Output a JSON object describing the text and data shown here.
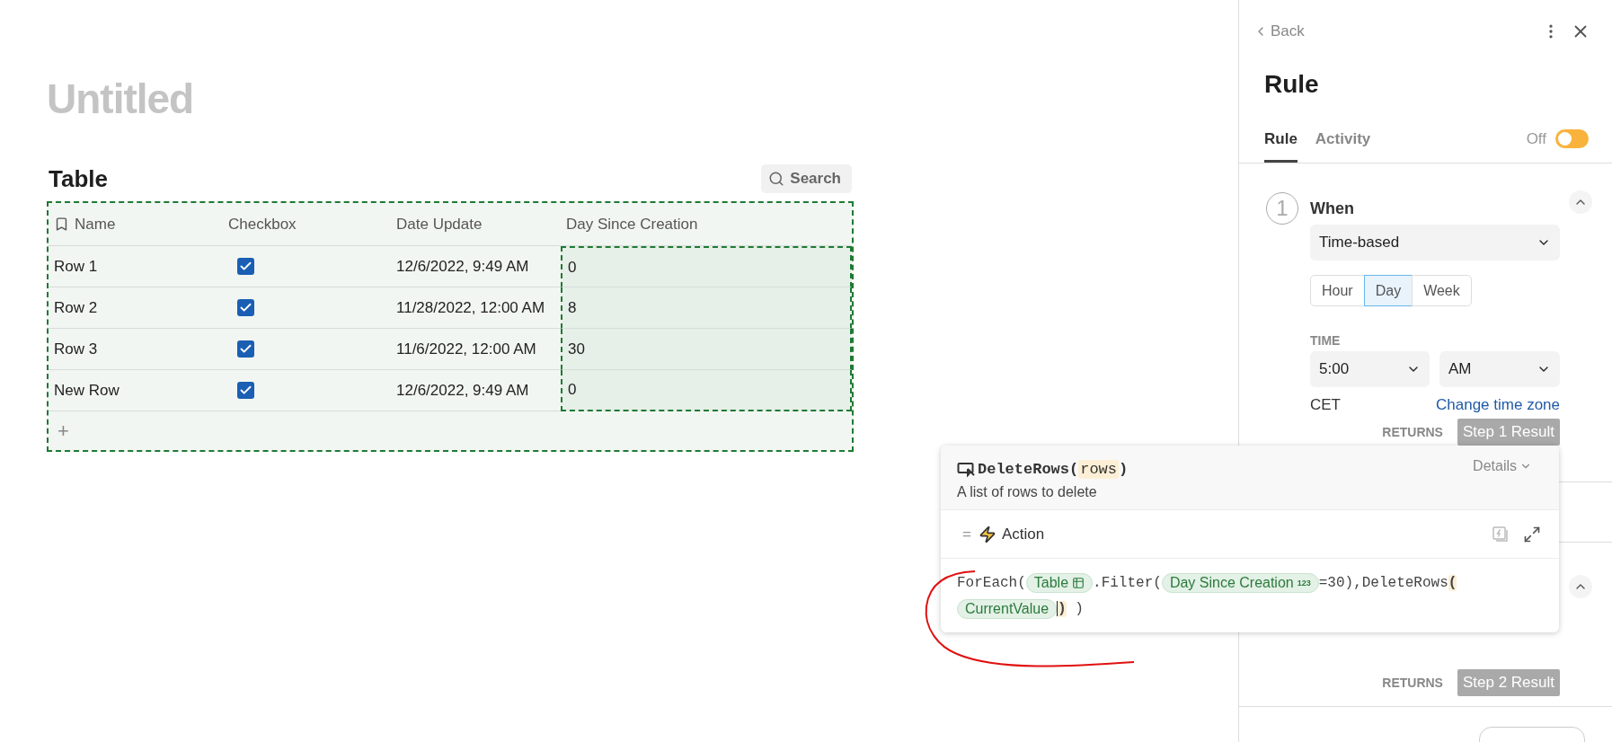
{
  "page": {
    "title": "Untitled"
  },
  "table": {
    "title": "Table",
    "search": "Search",
    "add": "+",
    "columns": [
      {
        "label": "Name",
        "selected": false
      },
      {
        "label": "Checkbox",
        "selected": false
      },
      {
        "label": "Date Update",
        "selected": false
      },
      {
        "label": "Day Since Creation",
        "selected": true
      }
    ],
    "rows": [
      {
        "name": "Row 1",
        "checked": true,
        "date": "12/6/2022, 9:49 AM",
        "days": "0"
      },
      {
        "name": "Row 2",
        "checked": true,
        "date": "11/28/2022, 12:00 AM",
        "days": "8"
      },
      {
        "name": "Row 3",
        "checked": true,
        "date": "11/6/2022, 12:00 AM",
        "days": "30"
      },
      {
        "name": "New Row",
        "checked": true,
        "date": "12/6/2022, 9:49 AM",
        "days": "0"
      }
    ]
  },
  "panel": {
    "back": "Back",
    "title": "Rule",
    "tabs": [
      {
        "label": "Rule",
        "selected": true
      },
      {
        "label": "Activity",
        "selected": false
      }
    ],
    "toggle": {
      "label": "Off",
      "on": false
    },
    "step1": {
      "number": "1",
      "title": "When",
      "expanded": true,
      "trigger": "Time-based",
      "periods": [
        {
          "label": "Hour",
          "selected": false
        },
        {
          "label": "Day",
          "selected": true
        },
        {
          "label": "Week",
          "selected": false
        }
      ],
      "time_label": "TIME",
      "time": "5:00",
      "ampm": "AM",
      "timezone": "CET",
      "change_link": "Change time zone",
      "returns_label": "RETURNS",
      "returns": "Step 1 Result"
    },
    "step2": {
      "expanded": true,
      "returns_label": "RETURNS",
      "returns": "Step 2 Result"
    }
  },
  "popup": {
    "signature": [
      {
        "kind": "plain",
        "text": "DeleteRows("
      },
      {
        "kind": "param",
        "text": "rows"
      },
      {
        "kind": "plain",
        "text": ")"
      }
    ],
    "description": "A list of rows to delete",
    "details": "Details",
    "eq": "=",
    "action": "Action",
    "code_lines": [
      [
        {
          "kind": "plain",
          "text": "ForEach("
        },
        {
          "kind": "table",
          "text": "Table"
        },
        {
          "kind": "plain",
          "text": ".Filter("
        },
        {
          "kind": "chip",
          "text": "Day Since Creation",
          "badge": "123"
        },
        {
          "kind": "plain",
          "text": "=30),DeleteRows"
        },
        {
          "kind": "match",
          "text": "("
        }
      ],
      [
        {
          "kind": "chip",
          "text": "CurrentValue"
        },
        {
          "kind": "match",
          "text": ")",
          "cursor": true
        },
        {
          "kind": "plain",
          "text": " )"
        }
      ]
    ]
  }
}
